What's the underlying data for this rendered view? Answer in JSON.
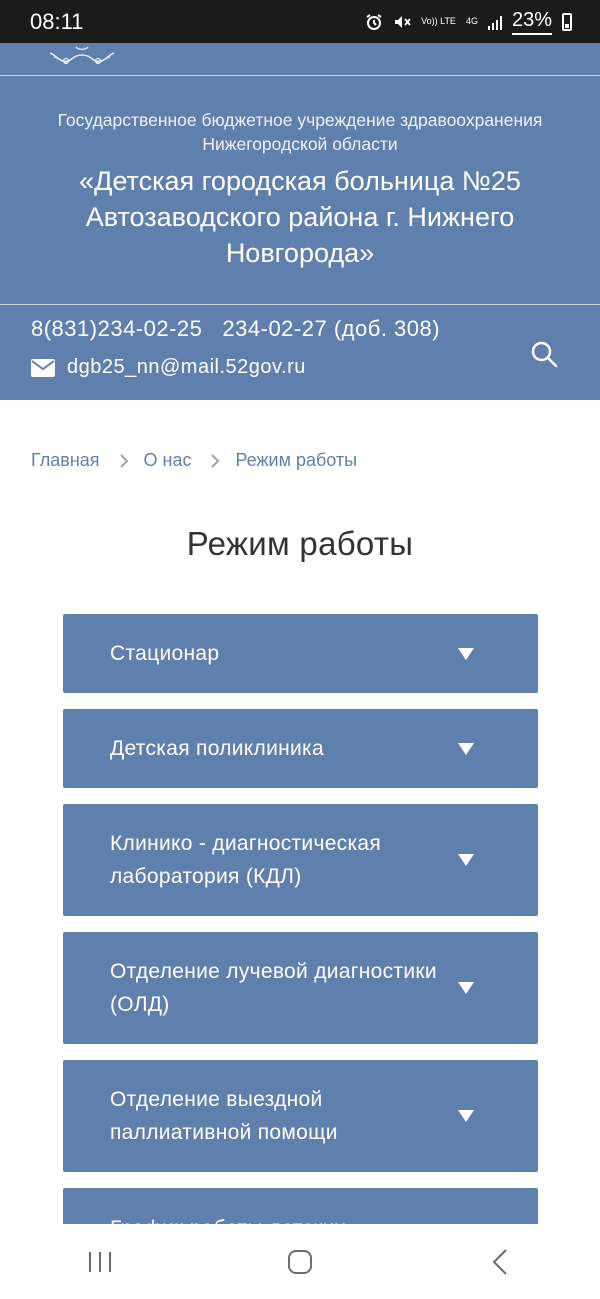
{
  "status_bar": {
    "time": "08:11",
    "volte_label": "Vo)) LTE",
    "network_label": "4G",
    "battery_percent": "23%",
    "icons": [
      "alarm-icon",
      "mute-icon",
      "volte-icon",
      "network-4g-icon",
      "signal-icon",
      "battery-icon"
    ]
  },
  "header": {
    "org_subtitle": "Государственное бюджетное учреждение здравоохранения Нижегородской области",
    "org_title": "«Детская городская больница №25 Автозаводского района г. Нижнего Новгорода»",
    "phone_1": "8(831)234-02-25",
    "phone_2": "234-02-27 (доб. 308)",
    "email": "dgb25_nn@mail.52gov.ru",
    "accent_color": "#5f80ad"
  },
  "breadcrumb": {
    "items": [
      "Главная",
      "О нас",
      "Режим работы"
    ]
  },
  "page_title": "Режим работы",
  "accordion": {
    "items": [
      {
        "label": "Стационар"
      },
      {
        "label": "Детская поликлиника"
      },
      {
        "label": "Клинико - диагностическая лаборатория (КДЛ)"
      },
      {
        "label": "Отделение лучевой диагностики (ОЛД)"
      },
      {
        "label": "Отделение выездной паллиативной помощи"
      },
      {
        "label": "График работы детских"
      }
    ]
  },
  "nav_bar": {
    "icons": [
      "recent-apps-icon",
      "home-icon",
      "back-icon"
    ]
  }
}
